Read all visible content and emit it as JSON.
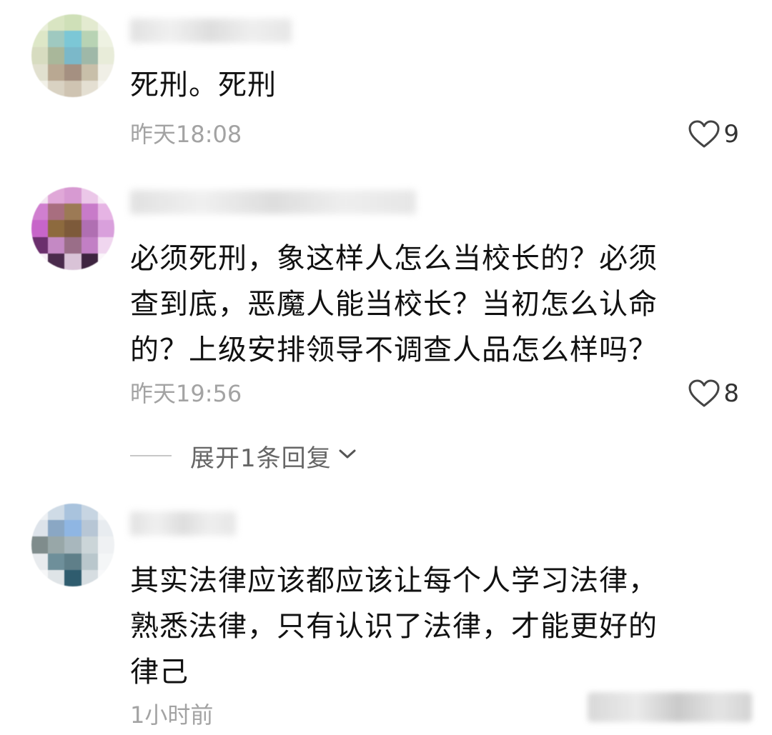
{
  "comments": [
    {
      "avatar_palette": [
        "#e9efd9",
        "#d9e5c2",
        "#cfe0b8",
        "#e3ead0",
        "#f2f4ea",
        "#dde7c7",
        "#9fc9c0",
        "#7cc7d6",
        "#b8d3b4",
        "#eef2e2",
        "#d7dcc0",
        "#a9b79a",
        "#7bb8c9",
        "#9fb8a8",
        "#e8ecd9",
        "#e1e0cf",
        "#b9a892",
        "#a59081",
        "#c8bfa9",
        "#f0efe6",
        "#f2f1e8",
        "#d9d2c2",
        "#cfc4b2",
        "#e4dfd2",
        "#f6f5f0"
      ],
      "text_lines": [
        "死刑。死刑"
      ],
      "time": "昨天18:08",
      "likes": "9"
    },
    {
      "avatar_palette": [
        "#f4e6f2",
        "#e0a8d8",
        "#d79ad2",
        "#ebc7e8",
        "#f8eef7",
        "#d07fcf",
        "#a86e7f",
        "#9c7a55",
        "#c87bc9",
        "#e6b4e4",
        "#c765c9",
        "#8d6a3e",
        "#7d5a3a",
        "#b06fb2",
        "#d9a0dc",
        "#6b2f6d",
        "#c489c4",
        "#9a6e88",
        "#c27fc5",
        "#f0d6ef",
        "#f7eef6",
        "#4a2b4c",
        "#d9c3d7",
        "#3e2440",
        "#fbf6fa"
      ],
      "text_lines": [
        "必须死刑，象这样人怎么当校长的？必须",
        "查到底，恶魔人能当校长？当初怎么认命",
        "的？上级安排领导不调查人品怎么样吗？"
      ],
      "time": "昨天19:56",
      "likes": "8"
    },
    {
      "avatar_palette": [
        "#eef1f4",
        "#cfdbe6",
        "#a9c3dd",
        "#c7d5e2",
        "#f3f5f7",
        "#dde3ea",
        "#8aa7c4",
        "#8fb6e3",
        "#b7c6d5",
        "#e8ecf0",
        "#7f8c8c",
        "#98a7a8",
        "#a8b7bd",
        "#cbd5d8",
        "#eff1f3",
        "#e8ebee",
        "#6e8f9a",
        "#5f7f89",
        "#b9c7cc",
        "#f4f6f7",
        "#f6f7f8",
        "#dfe4e7",
        "#2f5c6e",
        "#d6dde1",
        "#f8f9fa"
      ],
      "text_lines": [
        "其实法律应该都应该让每个人学习法律，",
        "熟悉法律，只有认识了法律，才能更好的",
        "律己"
      ],
      "time": "1小时前"
    }
  ],
  "expand_replies_label": "展开1条回复",
  "icons": {
    "like": "heart-outline-icon",
    "expand": "chevron-down-icon"
  },
  "colors": {
    "text": "#111111",
    "meta": "#a3a3a3",
    "expand": "#666666"
  }
}
